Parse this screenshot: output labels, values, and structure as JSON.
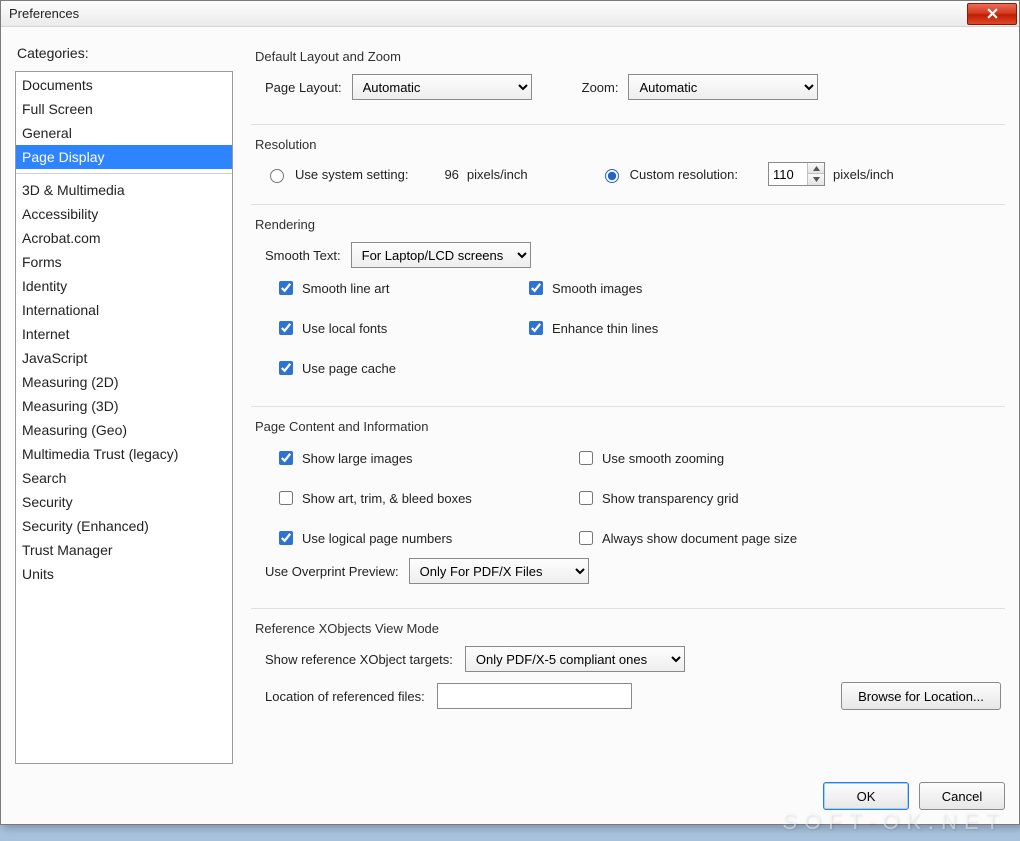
{
  "window": {
    "title": "Preferences"
  },
  "sidebar": {
    "label": "Categories:",
    "items_top": [
      "Documents",
      "Full Screen",
      "General",
      "Page Display"
    ],
    "selected_index": 3,
    "items_bottom": [
      "3D & Multimedia",
      "Accessibility",
      "Acrobat.com",
      "Forms",
      "Identity",
      "International",
      "Internet",
      "JavaScript",
      "Measuring (2D)",
      "Measuring (3D)",
      "Measuring (Geo)",
      "Multimedia Trust (legacy)",
      "Search",
      "Security",
      "Security (Enhanced)",
      "Trust Manager",
      "Units"
    ]
  },
  "layout_zoom": {
    "title": "Default Layout and Zoom",
    "page_layout_label": "Page Layout:",
    "page_layout_value": "Automatic",
    "zoom_label": "Zoom:",
    "zoom_value": "Automatic"
  },
  "resolution": {
    "title": "Resolution",
    "use_system_label": "Use system setting:",
    "system_value": "96",
    "units": "pixels/inch",
    "custom_label": "Custom resolution:",
    "custom_value": "110",
    "selected": "custom"
  },
  "rendering": {
    "title": "Rendering",
    "smooth_text_label": "Smooth Text:",
    "smooth_text_value": "For Laptop/LCD screens",
    "checks": {
      "smooth_line_art": {
        "label": "Smooth line art",
        "checked": true
      },
      "smooth_images": {
        "label": "Smooth images",
        "checked": true
      },
      "use_local_fonts": {
        "label": "Use local fonts",
        "checked": true
      },
      "enhance_thin_lines": {
        "label": "Enhance thin lines",
        "checked": true
      },
      "use_page_cache": {
        "label": "Use page cache",
        "checked": true
      }
    }
  },
  "page_content": {
    "title": "Page Content and Information",
    "checks": {
      "show_large_images": {
        "label": "Show large images",
        "checked": true
      },
      "use_smooth_zooming": {
        "label": "Use smooth zooming",
        "checked": false
      },
      "show_art_trim_bleed": {
        "label": "Show art, trim, & bleed boxes",
        "checked": false
      },
      "show_transparency_grid": {
        "label": "Show transparency grid",
        "checked": false
      },
      "use_logical_page_numbers": {
        "label": "Use logical page numbers",
        "checked": true
      },
      "always_show_doc_page_size": {
        "label": "Always show document page size",
        "checked": false
      }
    },
    "overprint_label": "Use Overprint Preview:",
    "overprint_value": "Only For PDF/X Files"
  },
  "xobjects": {
    "title": "Reference XObjects View Mode",
    "targets_label": "Show reference XObject targets:",
    "targets_value": "Only PDF/X-5 compliant ones",
    "location_label": "Location of referenced files:",
    "location_value": "",
    "browse_label": "Browse for Location..."
  },
  "footer": {
    "ok": "OK",
    "cancel": "Cancel"
  },
  "watermark": "SOFT-OK.NET"
}
